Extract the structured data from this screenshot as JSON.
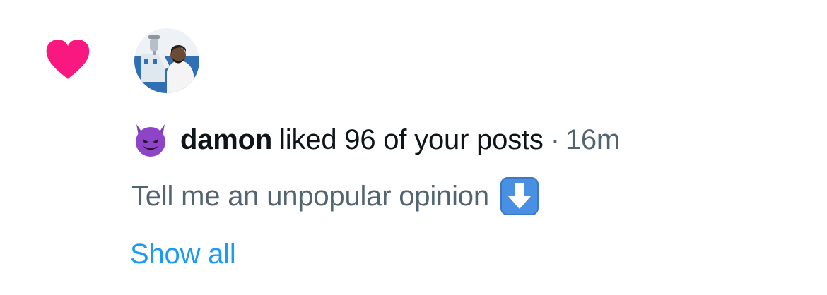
{
  "notification": {
    "type_icon": "heart-icon",
    "type_icon_color": "#f91880",
    "avatar": "profile-photo-trophy",
    "user_emoji": "smiling-devil-emoji",
    "user_name": "damon",
    "action_text": "liked 96 of your posts",
    "separator": "·",
    "time": "16m",
    "post_text": "Tell me an unpopular opinion",
    "post_emoji": "down-arrow-emoji",
    "show_all_label": "Show all"
  },
  "colors": {
    "primary_text": "#0f1419",
    "secondary_text": "#536471",
    "link": "#1d9bf0",
    "like": "#f91880",
    "emoji_devil": "#8e44c6",
    "emoji_arrow": "#4a90e2"
  }
}
